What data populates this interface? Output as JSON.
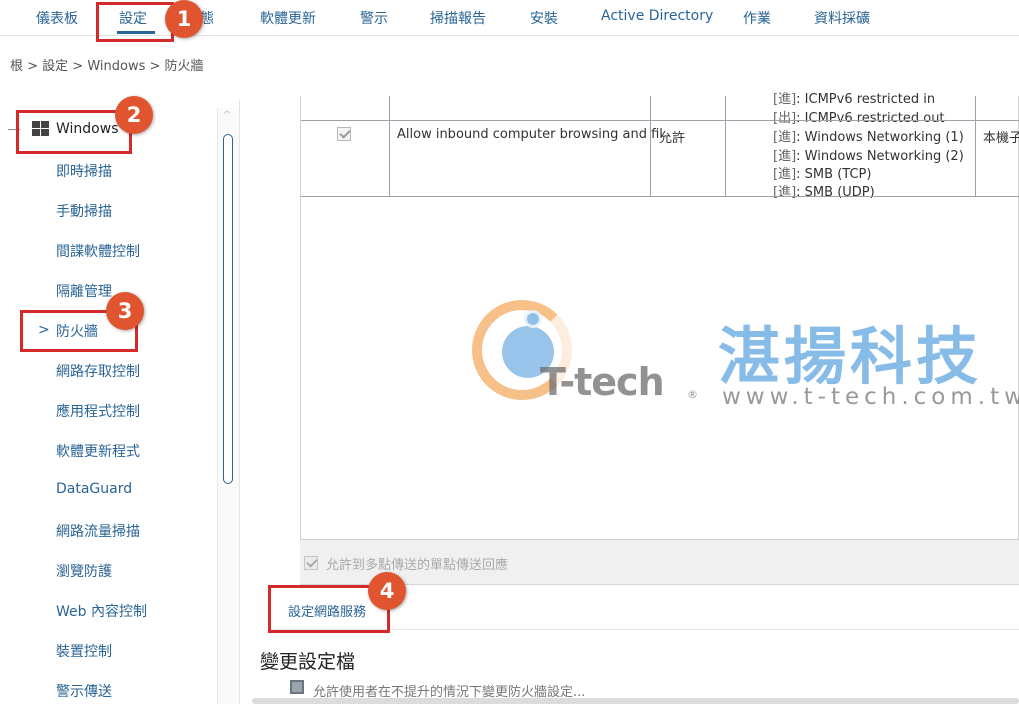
{
  "topnav": {
    "items": [
      "儀表板",
      "設定",
      "態",
      "軟體更新",
      "警示",
      "掃描報告",
      "安裝",
      "Active Directory",
      "作業",
      "資料採礦"
    ]
  },
  "breadcrumb": "根 > 設定 > Windows > 防火牆",
  "sidebar": {
    "header": "Windows",
    "items": [
      "即時掃描",
      "手動掃描",
      "間諜軟體控制",
      "隔離管理",
      "防火牆",
      "網路存取控制",
      "應用程式控制",
      "軟體更新程式",
      "DataGuard",
      "網路流量掃描",
      "瀏覽防護",
      "Web 內容控制",
      "裝置控制",
      "警示傳送"
    ],
    "chevron": ">",
    "scroll_up": "^"
  },
  "rules": {
    "partial_row": {
      "lines": [
        {
          "tag": "[進]",
          "text": ": ICMPv6 restricted in"
        },
        {
          "tag": "[出]",
          "text": ": ICMPv6 restricted out"
        }
      ]
    },
    "row": {
      "name": "Allow inbound computer browsing and fil",
      "action": "允許",
      "services": [
        {
          "tag": "[進]",
          "text": ": Windows Networking (1)"
        },
        {
          "tag": "[進]",
          "text": ": Windows Networking (2)"
        },
        {
          "tag": "[進]",
          "text": ": SMB (TCP)"
        },
        {
          "tag": "[進]",
          "text": ": SMB (UDP)"
        }
      ],
      "scope": "本機子"
    }
  },
  "multicast_label": "允許到多點傳送的單點傳送回應",
  "network_service_link": "設定網路服務",
  "section_title": "變更設定檔",
  "allow_change_label": "允許使用者在不提升的情況下變更防火牆設定...",
  "watermark": {
    "brand": "T-tech",
    "reg": "®",
    "chinese_name": "湛揚科技",
    "url": "www.t-tech.com.tw"
  },
  "callouts": [
    "1",
    "2",
    "3",
    "4"
  ],
  "colors": {
    "link": "#2a6496",
    "callout": "#e0552f",
    "highlight_border": "#d42a2a"
  }
}
